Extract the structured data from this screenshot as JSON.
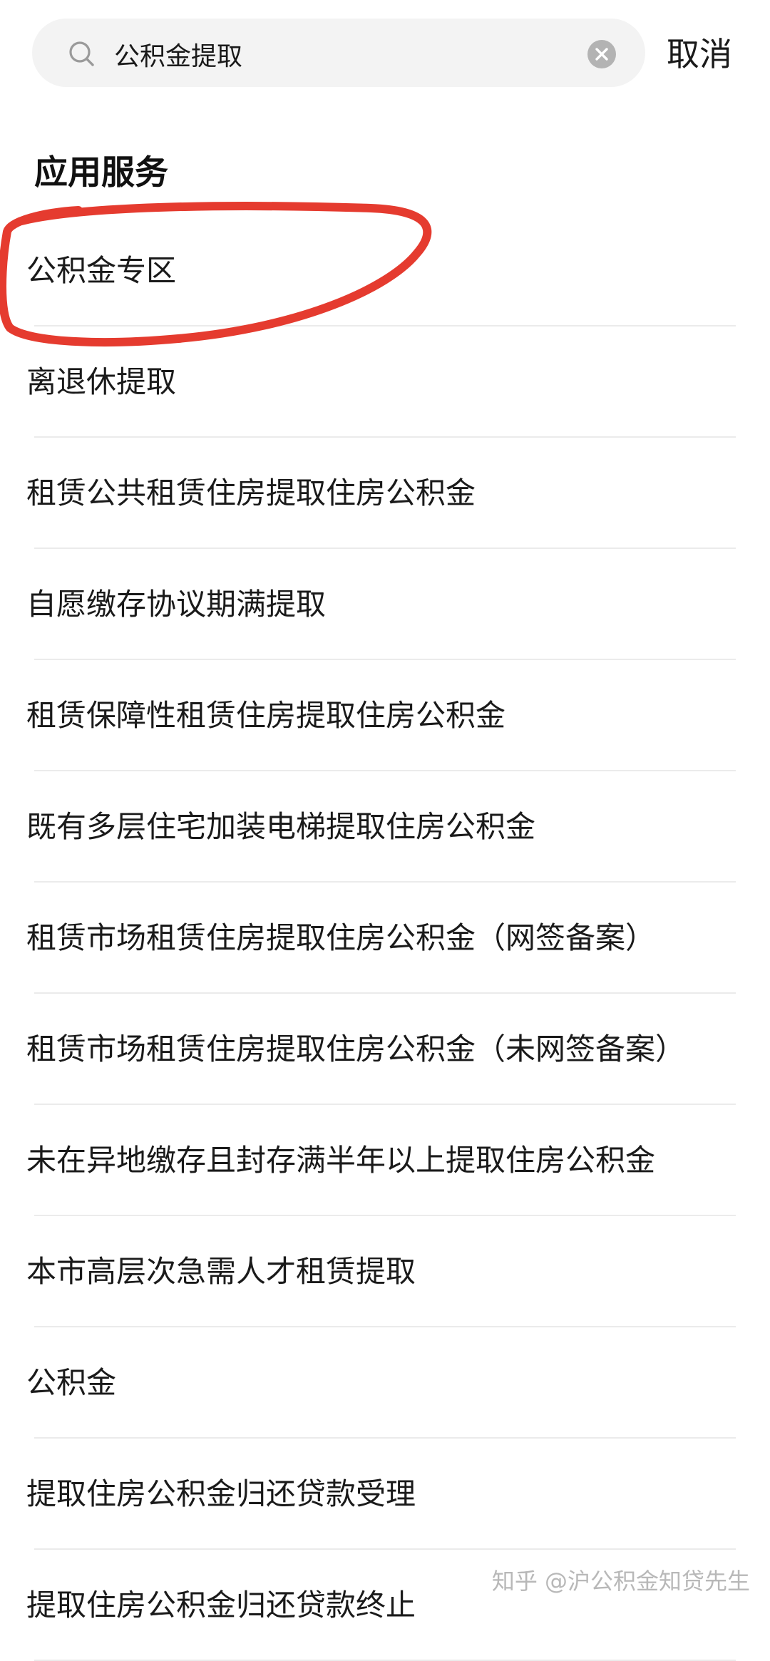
{
  "search": {
    "query": "公积金提取",
    "cancel_label": "取消"
  },
  "section_title": "应用服务",
  "results": [
    {
      "label": "公积金专区"
    },
    {
      "label": "离退休提取"
    },
    {
      "label": "租赁公共租赁住房提取住房公积金"
    },
    {
      "label": "自愿缴存协议期满提取"
    },
    {
      "label": "租赁保障性租赁住房提取住房公积金"
    },
    {
      "label": "既有多层住宅加装电梯提取住房公积金"
    },
    {
      "label": "租赁市场租赁住房提取住房公积金（网签备案）"
    },
    {
      "label": "租赁市场租赁住房提取住房公积金（未网签备案）"
    },
    {
      "label": "未在异地缴存且封存满半年以上提取住房公积金"
    },
    {
      "label": "本市高层次急需人才租赁提取"
    },
    {
      "label": "公积金"
    },
    {
      "label": "提取住房公积金归还贷款受理"
    },
    {
      "label": "提取住房公积金归还贷款终止"
    }
  ],
  "watermark": "知乎 @沪公积金知贷先生",
  "colors": {
    "highlight_stroke": "#e53b2f",
    "search_bg": "#f3f3f3",
    "divider": "#ebebeb"
  },
  "icons": {
    "search": "search-icon",
    "clear": "clear-icon"
  }
}
